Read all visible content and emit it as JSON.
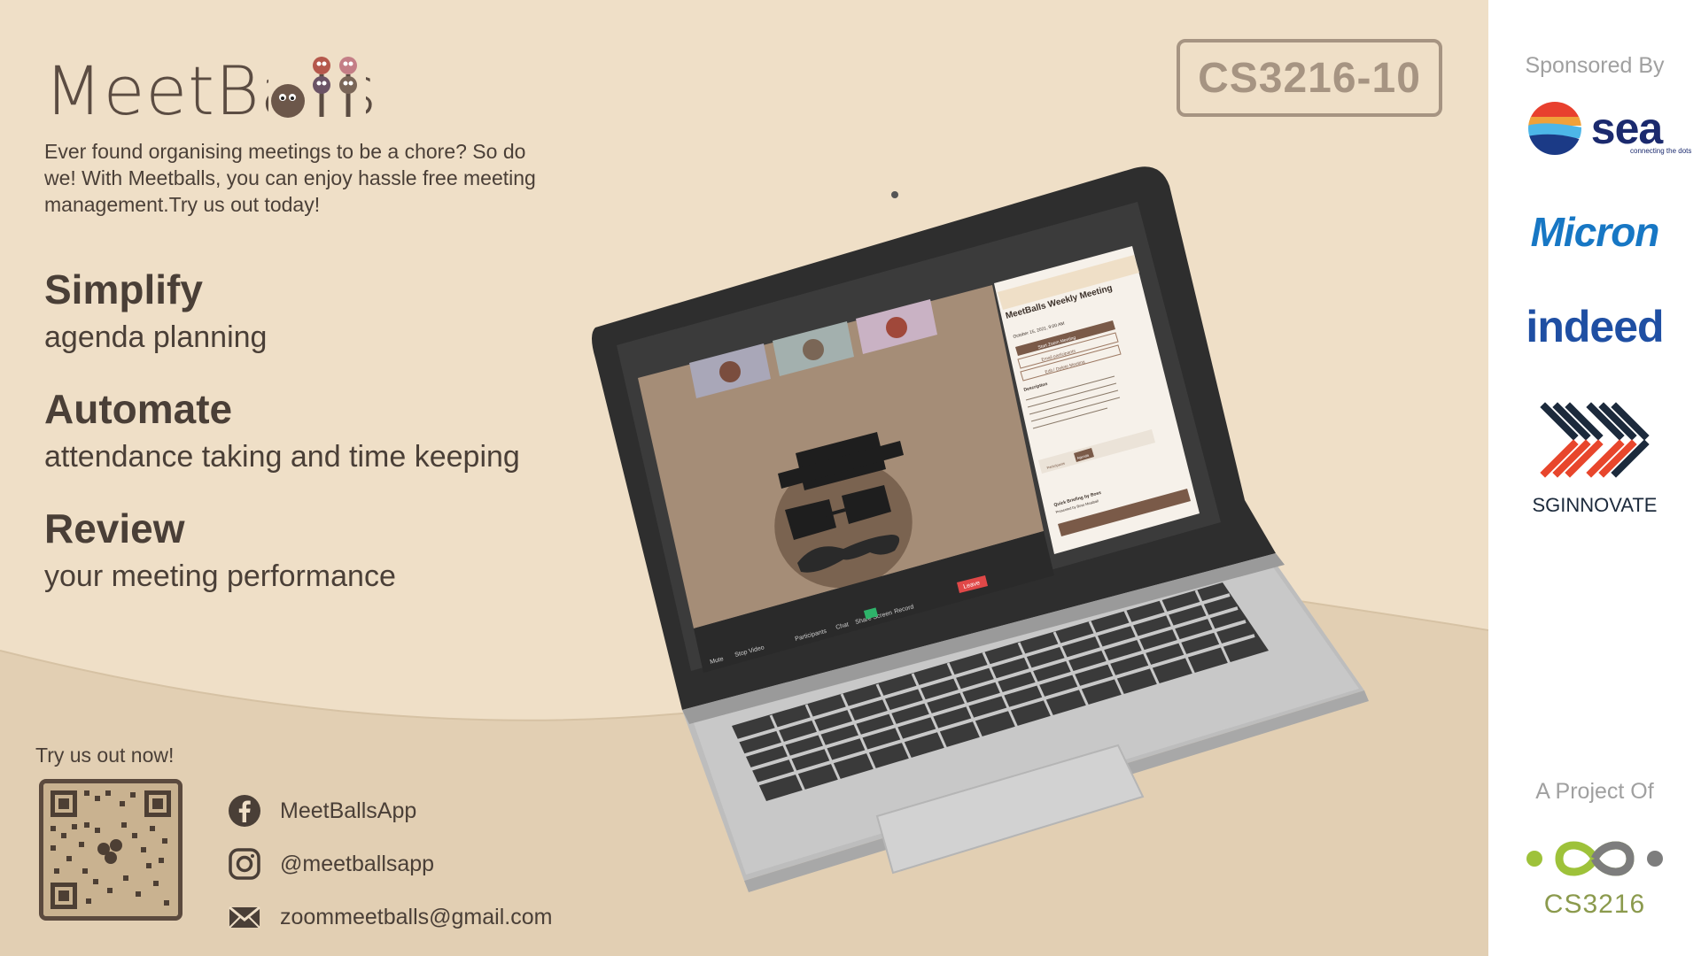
{
  "brand": {
    "name": "MeetBalls",
    "tagline": "Ever found organising meetings to be a chore? So do we! With Meetballs, you can enjoy hassle free meeting management.Try us out today!"
  },
  "course_code": "CS3216-10",
  "features": [
    {
      "title": "Simplify",
      "subtitle": "agenda planning"
    },
    {
      "title": "Automate",
      "subtitle": "attendance taking and time keeping"
    },
    {
      "title": "Review",
      "subtitle": "your meeting performance"
    }
  ],
  "cta": {
    "label": "Try us out now!"
  },
  "contacts": [
    {
      "icon": "facebook-icon",
      "text": "MeetBallsApp"
    },
    {
      "icon": "instagram-icon",
      "text": "@meetballsapp"
    },
    {
      "icon": "mail-icon",
      "text": "zoommeetballs@gmail.com"
    }
  ],
  "sidebar": {
    "sponsored_label": "Sponsored By",
    "sponsors": [
      {
        "name": "sea",
        "tagline": "connecting the dots"
      },
      {
        "name": "Micron"
      },
      {
        "name": "indeed"
      },
      {
        "name": "SGINNOVATE"
      }
    ],
    "project_label": "A Project Of",
    "project": "CS3216"
  },
  "laptop_screen": {
    "panel_title": "MeetBalls Weekly Meeting",
    "panel_date": "October 15, 2021, 9:00 AM",
    "start_button": "Start Zoom Meeting",
    "email_button": "Email participants",
    "edit_button": "Edit / Delete Meeting",
    "description_label": "Description",
    "tab_participants": "Participants",
    "tab_agenda": "Agenda",
    "agenda_item": "Quick Briefing by Boss",
    "agenda_presenter": "Presented by Boss Meatball",
    "toolbar": {
      "mute": "Mute",
      "stop_video": "Stop Video",
      "participants": "Participants",
      "chat": "Chat",
      "share_screen": "Share Screen",
      "record": "Record",
      "leave": "Leave"
    }
  },
  "colors": {
    "background": "#efdfc7",
    "lower_band": "#e2cfb3",
    "text": "#4a3f37",
    "badge": "#a69482",
    "sidebar": "#ffffff"
  }
}
